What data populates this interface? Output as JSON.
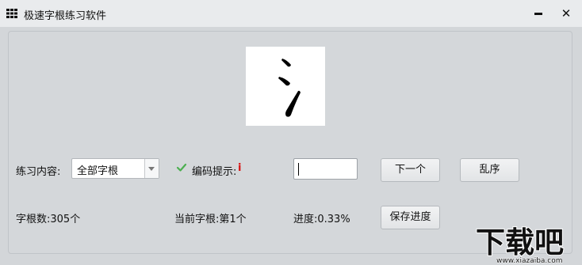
{
  "window": {
    "title": "极速字根练习软件",
    "minimize_icon": "minimize-icon",
    "close_icon": "close-icon",
    "close_glyph": "✕"
  },
  "preview": {
    "root_glyph": "氵"
  },
  "practice": {
    "content_label": "练习内容:",
    "content_select_value": "全部字根",
    "hint_label": "编码提示:",
    "hint_mark": "i",
    "hint_checked": true,
    "code_input_value": "",
    "next_button": "下一个",
    "shuffle_button": "乱序"
  },
  "status": {
    "root_count": "字根数:305个",
    "current_root": "当前字根:第1个",
    "progress": "进度:0.33%",
    "save_button": "保存进度"
  },
  "watermark": {
    "text": "下载吧",
    "url_text": "www.xiazaiba.com"
  },
  "colors": {
    "hint_mark": "#d91414",
    "checkmark": "#4caf50"
  }
}
